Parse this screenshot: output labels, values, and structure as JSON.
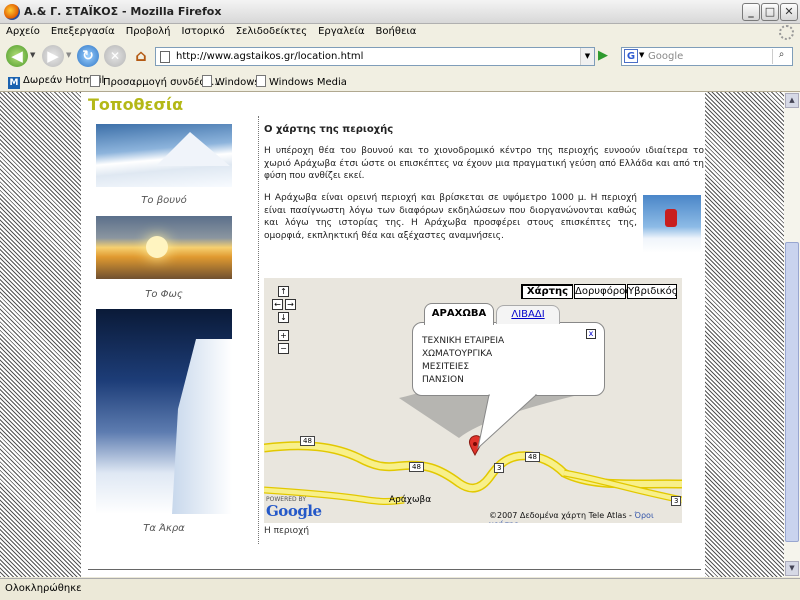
{
  "window": {
    "title": "Α.& Γ. ΣΤΑΪΚΟΣ - Mozilla Firefox",
    "min": "_",
    "max": "□",
    "close": "✕"
  },
  "menu": [
    "Αρχείο",
    "Επεξεργασία",
    "Προβολή",
    "Ιστορικό",
    "Σελιδοδείκτες",
    "Εργαλεία",
    "Βοήθεια"
  ],
  "navbar": {
    "url": "http://www.agstaikos.gr/location.html",
    "search_placeholder": "Google",
    "search_engine": "G"
  },
  "bookmarks": [
    "Δωρεάν Hotmail",
    "Προσαρμογή συνδέσε...",
    "Windows",
    "Windows Media"
  ],
  "page": {
    "heading": "Τοποθεσία",
    "captions": [
      "Το βουνό",
      "Το Φως",
      "Τα Άκρα"
    ],
    "section_title": "Ο χάρτης της περιοχής",
    "paragraph1": "Η υπέροχη θέα του βουνού και το χιονοδρομικό κέντρο της περιοχής ευνοούν ιδιαίτερα το χωριό Αράχωβα έτσι ώστε οι επισκέπτες να έχουν μια πραγματική γεύση από Ελλάδα και από τη φύση που ανθίζει εκεί.",
    "paragraph2": "Η Αράχωβα είναι ορεινή περιοχή και βρίσκεται σε υψόμετρο 1000 μ. Η περιοχή είναι πασίγνωστη λόγω των διαφόρων εκδηλώσεων που διοργανώνονται καθώς και λόγω της ιστορίας της. Η Αράχωβα προσφέρει στους επισκέπτες της, ομορφιά, εκπληκτική θέα και αξέχαστες αναμνήσεις.",
    "map_caption": "Η περιοχή"
  },
  "map": {
    "types": [
      "Χάρτης",
      "Δορυφόρος",
      "Υβριδικός"
    ],
    "controls": {
      "up": "↑",
      "left": "←",
      "right": "→",
      "down": "↓",
      "zoom_in": "+",
      "zoom_out": "−"
    },
    "tabs": [
      "ΑΡΑΧΩΒΑ",
      "ΛΙΒΑΔΙ"
    ],
    "info_lines": [
      "ΤΕΧΝΙΚΗ ΕΤΑΙΡΕΙΑ",
      "ΧΩΜΑΤΟΥΡΓΙΚΑ",
      "ΜΕΣΙΤΕΙΕΣ",
      "ΠΑΝΣΙΟΝ"
    ],
    "info_close": "x",
    "road_labels": [
      "48",
      "48",
      "48",
      "3",
      "3"
    ],
    "town": "Αράχωβα",
    "powered_by": "POWERED BY",
    "google": "Google",
    "copyright": "©2007 Δεδομένα χάρτη Tele Atlas -",
    "terms": "Όροι χρήσης"
  },
  "status": "Ολοκληρώθηκε"
}
